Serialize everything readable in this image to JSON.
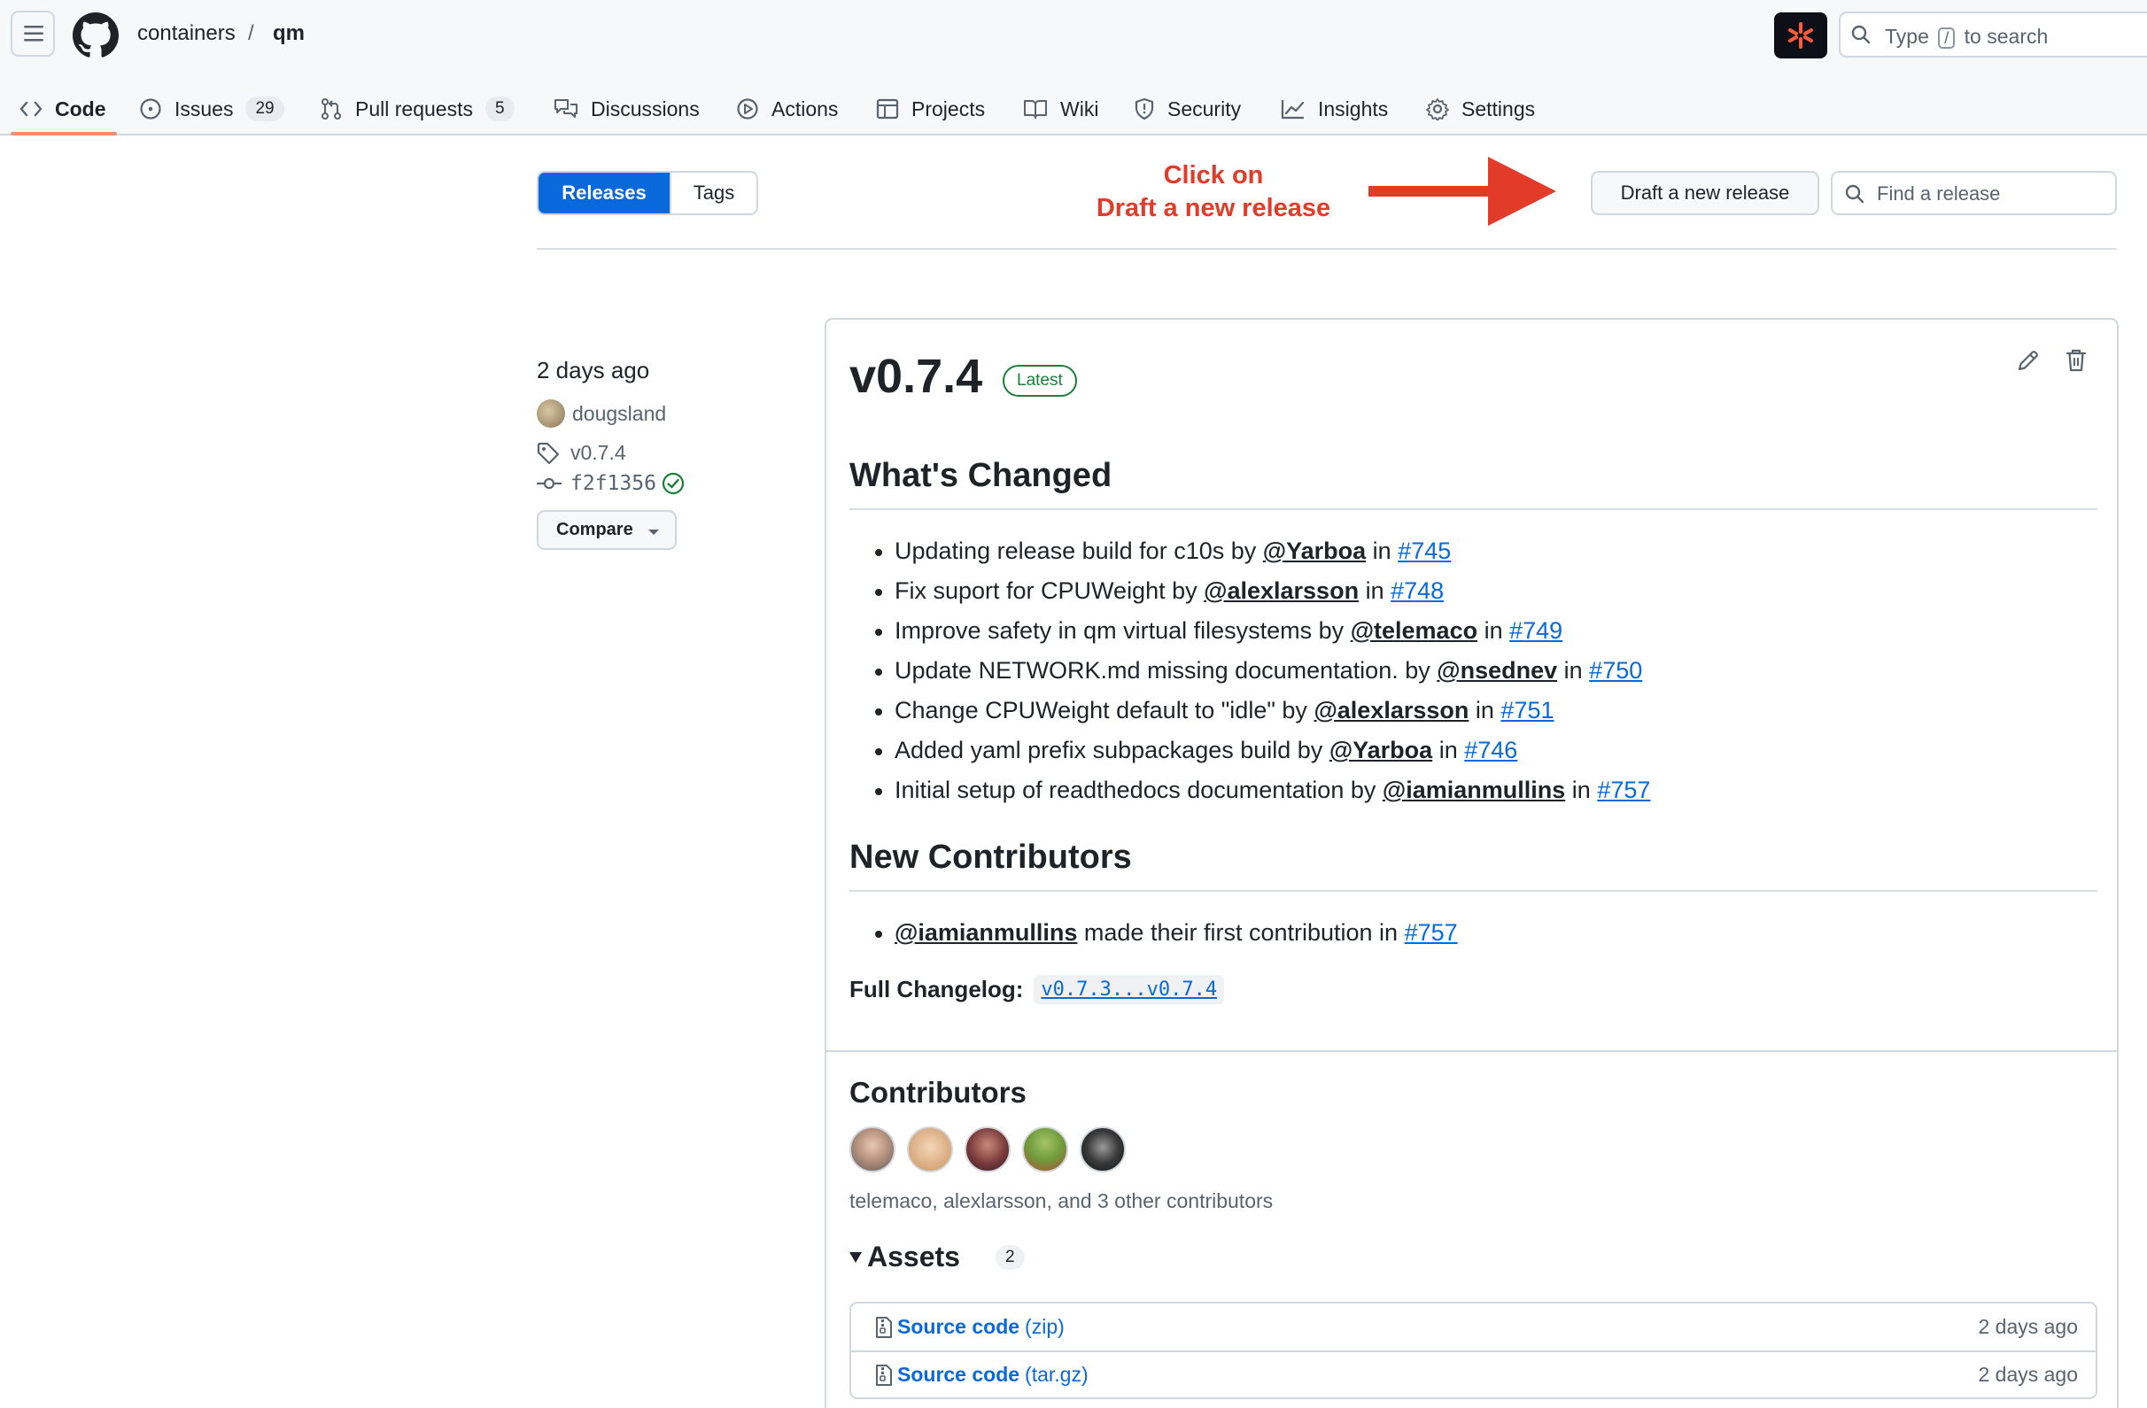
{
  "header": {
    "owner": "containers",
    "separator": "/",
    "repo": "qm",
    "search_prefix": "Type",
    "search_key": "/",
    "search_suffix": "to search"
  },
  "tabs": [
    {
      "label": "Code",
      "icon": "code-icon",
      "selected": true
    },
    {
      "label": "Issues",
      "icon": "issue-opened-icon",
      "count": "29"
    },
    {
      "label": "Pull requests",
      "icon": "git-pull-request-icon",
      "count": "5"
    },
    {
      "label": "Discussions",
      "icon": "comment-discussion-icon"
    },
    {
      "label": "Actions",
      "icon": "play-icon"
    },
    {
      "label": "Projects",
      "icon": "table-icon"
    },
    {
      "label": "Wiki",
      "icon": "book-icon"
    },
    {
      "label": "Security",
      "icon": "shield-icon"
    },
    {
      "label": "Insights",
      "icon": "graph-icon"
    },
    {
      "label": "Settings",
      "icon": "gear-icon"
    }
  ],
  "subnav": {
    "releases_label": "Releases",
    "tags_label": "Tags",
    "draft_label": "Draft a new release",
    "find_placeholder": "Find a release"
  },
  "annotation": {
    "line1": "Click on",
    "line2": "Draft a new release",
    "color": "#e33b2a"
  },
  "release": {
    "date": "2 days ago",
    "author": "dougsland",
    "tag": "v0.7.4",
    "commit": "f2f1356",
    "compare_label": "Compare",
    "title": "v0.7.4",
    "latest_badge": "Latest",
    "whats_changed_heading": "What's Changed",
    "changes": [
      {
        "text": "Updating release build for c10s by",
        "user": "@Yarboa",
        "in": "in",
        "pr": "#745"
      },
      {
        "text": "Fix suport for CPUWeight by",
        "user": "@alexlarsson",
        "in": "in",
        "pr": "#748"
      },
      {
        "text": "Improve safety in qm virtual filesystems by",
        "user": "@telemaco",
        "in": "in",
        "pr": "#749"
      },
      {
        "text": "Update NETWORK.md missing documentation. by",
        "user": "@nsednev",
        "in": "in",
        "pr": "#750"
      },
      {
        "text": "Change CPUWeight default to \"idle\" by",
        "user": "@alexlarsson",
        "in": "in",
        "pr": "#751"
      },
      {
        "text": "Added yaml prefix subpackages build by",
        "user": "@Yarboa",
        "in": "in",
        "pr": "#746"
      },
      {
        "text": "Initial setup of readthedocs documentation by",
        "user": "@iamianmullins",
        "in": "in",
        "pr": "#757"
      }
    ],
    "new_contributors_heading": "New Contributors",
    "new_contributors": [
      {
        "user": "@iamianmullins",
        "text": "made their first contribution in",
        "pr": "#757"
      }
    ],
    "full_changelog_label": "Full Changelog:",
    "full_changelog_range": "v0.7.3...v0.7.4",
    "contributors_heading": "Contributors",
    "contributors_text": "telemaco, alexlarsson, and 3 other contributors",
    "assets_heading": "Assets",
    "assets_count": "2",
    "assets": [
      {
        "name": "Source code",
        "ext": "(zip)",
        "date": "2 days ago"
      },
      {
        "name": "Source code",
        "ext": "(tar.gz)",
        "date": "2 days ago"
      }
    ]
  },
  "colors": {
    "accent": "#0969da",
    "tab_underline": "#fd8c73",
    "latest_green": "#1a7f37"
  }
}
